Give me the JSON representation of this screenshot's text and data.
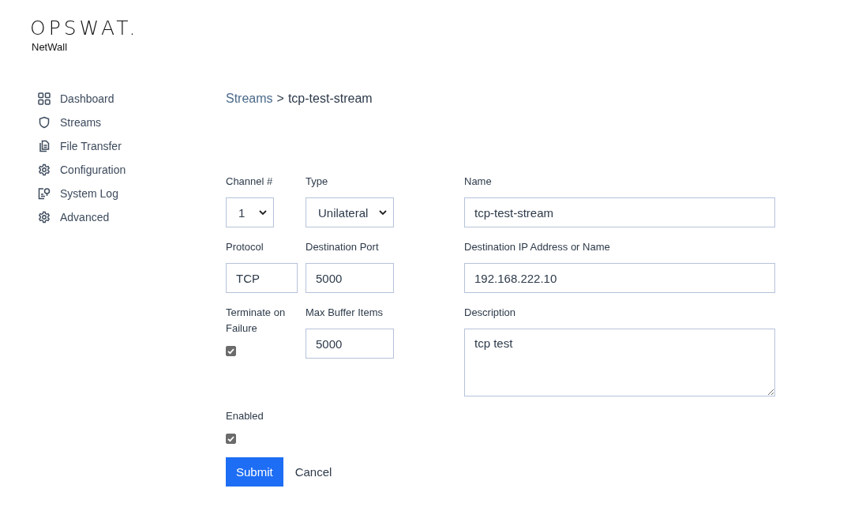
{
  "brand": {
    "logo": "OPSWAT.",
    "product": "NetWall"
  },
  "sidebar": {
    "items": [
      {
        "label": "Dashboard",
        "selected": false
      },
      {
        "label": "Streams",
        "selected": false
      },
      {
        "label": "File Transfer",
        "selected": false
      },
      {
        "label": "Configuration",
        "selected": false
      },
      {
        "label": "System Log",
        "selected": false
      },
      {
        "label": "Advanced",
        "selected": false
      }
    ]
  },
  "breadcrumb": {
    "link": "Streams",
    "separator": ">",
    "current": "tcp-test-stream"
  },
  "form": {
    "rows": [
      [
        {
          "kind": "select",
          "label": "Channel #",
          "value": "1"
        },
        {
          "kind": "select",
          "label": "Type",
          "value": "Unilateral"
        },
        {
          "kind": "text",
          "label": "Name",
          "value": "tcp-test-stream"
        }
      ],
      [
        {
          "kind": "text",
          "label": "Protocol",
          "value": "TCP"
        },
        {
          "kind": "text",
          "label": "Destination Port",
          "value": "5000"
        },
        {
          "kind": "text",
          "label": "Destination IP Address or Name",
          "value": "192.168.222.10"
        }
      ],
      [
        {
          "kind": "checkbox",
          "label": "Terminate on Failure",
          "checked": true
        },
        {
          "kind": "text",
          "label": "Max Buffer Items",
          "value": "5000"
        },
        {
          "kind": "textarea",
          "label": "Description",
          "value": "tcp test"
        }
      ],
      [
        {
          "kind": "checkbox",
          "label": "Enabled",
          "checked": true
        }
      ]
    ],
    "buttons": [
      {
        "kind": "primary",
        "label": "Submit"
      },
      {
        "kind": "plain",
        "label": "Cancel"
      }
    ]
  }
}
